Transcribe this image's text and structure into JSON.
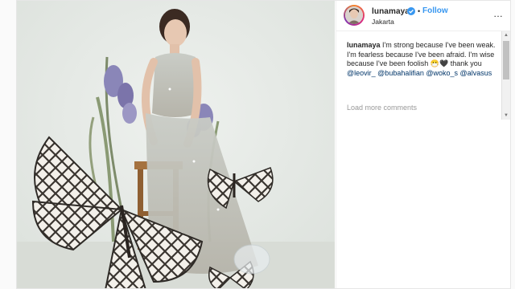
{
  "post": {
    "username": "lunamaya",
    "follow_label": "Follow",
    "separator": "•",
    "location": "Jakarta",
    "more_label": "…",
    "caption": {
      "username": "lunamaya",
      "line1": " I'm strong because I've been weak.",
      "line2": "I'm fearless because I've been afraid. I'm wise because I've been foolish 😷🖤 thank you ",
      "mentions": [
        "@leovir_",
        "@bubahalifian",
        "@woko_s",
        "@alvasus"
      ]
    },
    "load_more": "Load more comments"
  },
  "colors": {
    "link": "#3897f0",
    "mention": "#003569",
    "muted": "#999999"
  },
  "icons": {
    "verified": "verified-badge-icon",
    "more": "more-options-icon"
  }
}
